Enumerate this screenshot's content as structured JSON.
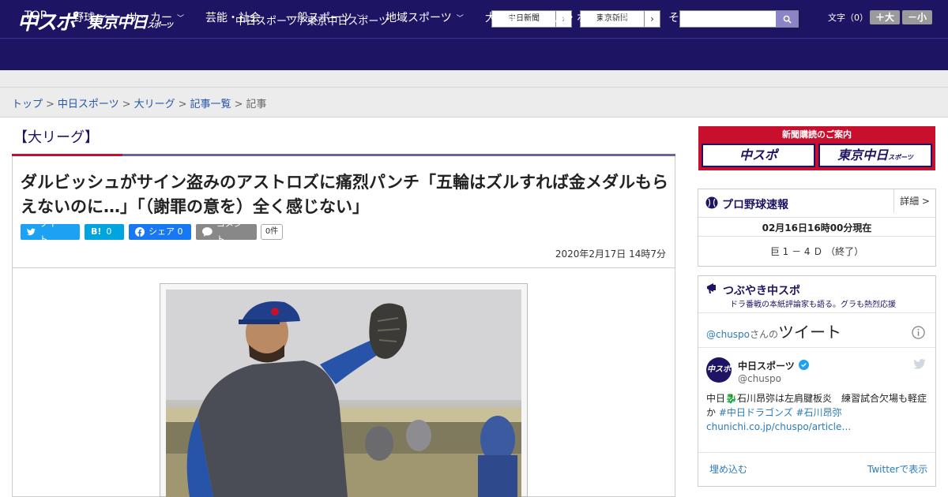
{
  "header": {
    "logo_chuspo": "中スポ",
    "logo_tokyo": "東京中日",
    "logo_tokyo_sub": "スポーツ",
    "site_name": "中日スポーツ / 東京中日スポーツ",
    "ext_links": [
      {
        "label": "中日新聞"
      },
      {
        "label": "東京新聞"
      }
    ],
    "search_placeholder": "",
    "font_size_label": "文字（0）",
    "font_bigger": "＋大",
    "font_smaller": "－小"
  },
  "nav": {
    "items": [
      {
        "label": "TOP",
        "dropdown": false
      },
      {
        "label": "野球",
        "dropdown": true
      },
      {
        "label": "サッカー",
        "dropdown": true
      },
      {
        "label": "芸能・社会",
        "dropdown": false
      },
      {
        "label": "一般スポーツ",
        "dropdown": true
      },
      {
        "label": "地域スポーツ",
        "dropdown": true
      },
      {
        "label": "大相撲",
        "dropdown": false
      },
      {
        "label": "競馬・ボート・競輪",
        "dropdown": false
      },
      {
        "label": "その他",
        "dropdown": true
      }
    ]
  },
  "breadcrumb": {
    "items": [
      "トップ",
      "中日スポーツ",
      "大リーグ",
      "記事一覧"
    ],
    "current": "記事",
    "separator": ">"
  },
  "article": {
    "category": "【大リーグ】",
    "headline": "ダルビッシュがサイン盗みのアストロズに痛烈パンチ「五輪はズルすれば金メダルもらえないのに…」「（謝罪の意を）全く感じない」",
    "share": {
      "tweet": "ツイート",
      "hatena_count": "0",
      "facebook": "シェア 0",
      "comment": "コメント",
      "comment_count": "0件"
    },
    "date": "2020年2月17日 14時7分"
  },
  "sidebar": {
    "ad": {
      "title": "新聞購読のご案内",
      "left": "中スポ",
      "right": "東京中日",
      "right_sub": "スポーツ"
    },
    "baseball": {
      "title": "プロ野球速報",
      "detail": "詳細 >",
      "timestamp": "02月16日16時00分現在",
      "score": "巨 1 － 4 Ｄ （終了）"
    },
    "twitter": {
      "title": "つぶやき中スポ",
      "subtitle": "ドラ番戦の本紙評論家も語る。グラも熱烈応援",
      "handle_prefix": "@chuspo",
      "handle_suffix": "さんの",
      "tweets_label": "ツイート",
      "account_name": "中日スポーツ",
      "account_handle": "@chuspo",
      "tweet_text_1": "中日",
      "tweet_text_2": "石川昂弥は左肩腱板炎　練習試合欠場も軽症か",
      "tweet_hashtags": "#中日ドラゴンズ #石川昂弥",
      "tweet_link": "chunichi.co.jp/chuspo/article…",
      "embed": "埋め込む",
      "view_on": "Twitterで表示"
    }
  },
  "colors": {
    "brand": "#1d1464",
    "accent_red": "#c8102e",
    "twitter": "#1da1f2",
    "hatena": "#00a4de",
    "facebook": "#1877f2"
  }
}
